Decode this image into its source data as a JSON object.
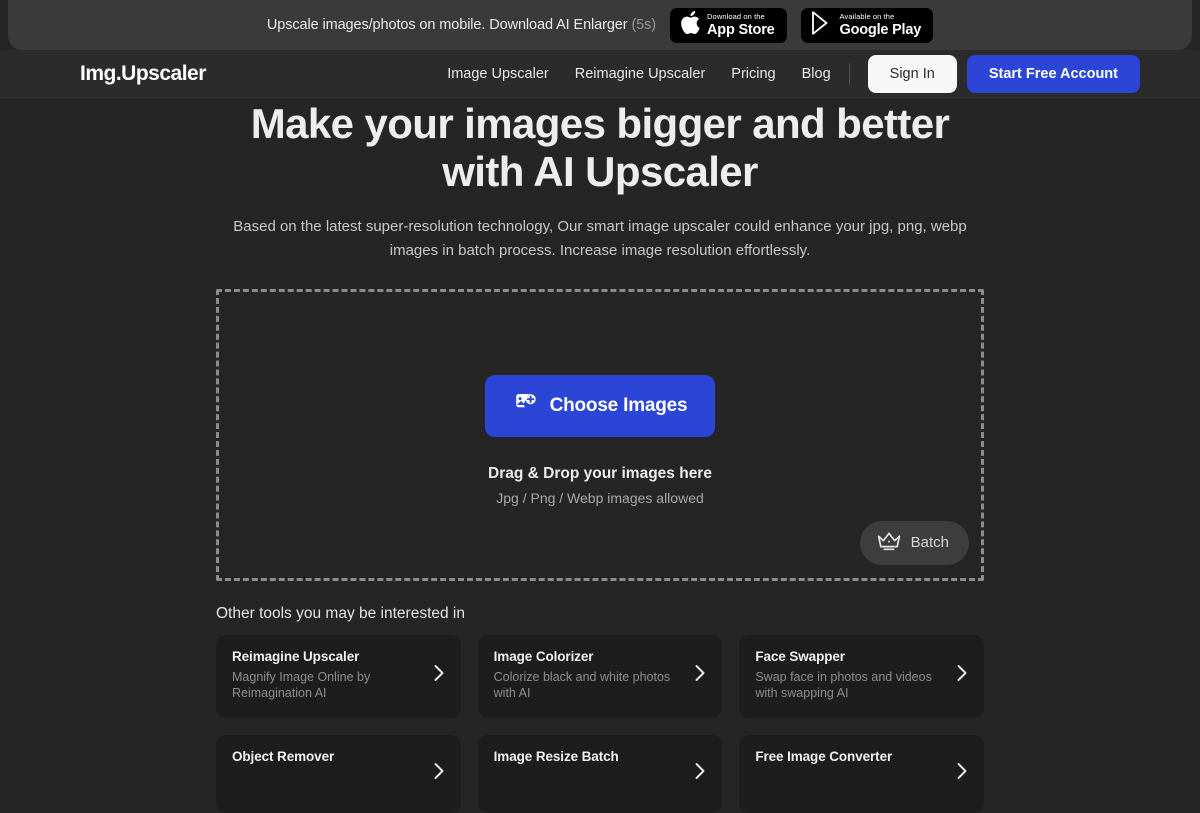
{
  "promo": {
    "text": "Upscale images/photos on mobile. Download AI Enlarger",
    "timer": "(5s)",
    "badges": [
      {
        "icon": "apple-icon",
        "small": "Download on the",
        "big": "App Store"
      },
      {
        "icon": "google-play-icon",
        "small": "Available on the",
        "big": "Google Play"
      }
    ]
  },
  "nav": {
    "brand": "Img.Upscaler",
    "links": [
      {
        "label": "Image Upscaler"
      },
      {
        "label": "Reimagine Upscaler"
      },
      {
        "label": "Pricing"
      },
      {
        "label": "Blog"
      }
    ],
    "sign_in": "Sign In",
    "start_free": "Start Free Account"
  },
  "hero": {
    "title": "Make your images bigger and better with AI Upscaler",
    "subtitle": "Based on the latest super-resolution technology, Our smart image upscaler could enhance your jpg, png, webp images in batch process. Increase image resolution effortlessly."
  },
  "dropzone": {
    "choose_label": "Choose Images",
    "drag_title": "Drag & Drop your images here",
    "formats": "Jpg / Png / Webp images allowed",
    "batch_label": "Batch"
  },
  "tools": {
    "heading": "Other tools you may be interested in",
    "items": [
      {
        "title": "Reimagine Upscaler",
        "desc": "Magnify Image Online by Reimagination AI"
      },
      {
        "title": "Image Colorizer",
        "desc": "Colorize black and white photos with AI"
      },
      {
        "title": "Face Swapper",
        "desc": "Swap face in photos and videos with swapping AI"
      },
      {
        "title": "Object Remover",
        "desc": ""
      },
      {
        "title": "Image Resize Batch",
        "desc": ""
      },
      {
        "title": "Free Image Converter",
        "desc": ""
      }
    ]
  },
  "colors": {
    "accent": "#2b46d6",
    "page_bg": "#252525",
    "nav_bg": "#2b2b2b",
    "promo_bg": "#3a3a3a",
    "card_bg": "#1d1d1d"
  }
}
